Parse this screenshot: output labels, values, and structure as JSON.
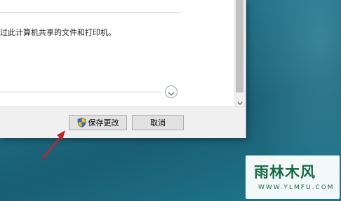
{
  "dialog": {
    "description": "过此计算机共享的文件和打印机。",
    "footer": {
      "save_label": "保存更改",
      "cancel_label": "取消"
    }
  },
  "watermark": {
    "title": "雨林木风",
    "url": "WWW.YLMFU.COM"
  },
  "colors": {
    "desktop": "#1d6b80",
    "arrow": "#c0282d",
    "watermark_text": "#176b45",
    "shield_blue": "#2f6fd6",
    "shield_yellow": "#f2c200"
  },
  "icons": [
    "expand-chevron-icon",
    "scroll-down-icon",
    "uac-shield-icon",
    "red-arrow-annotation"
  ]
}
